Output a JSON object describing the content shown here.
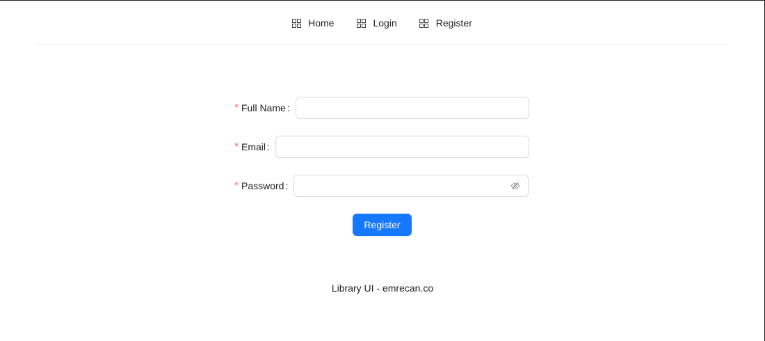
{
  "nav": {
    "items": [
      {
        "label": "Home",
        "icon": "appstore-icon"
      },
      {
        "label": "Login",
        "icon": "appstore-icon"
      },
      {
        "label": "Register",
        "icon": "appstore-icon"
      }
    ]
  },
  "form": {
    "full_name": {
      "label": "Full Name",
      "required_mark": "*",
      "colon": ":",
      "value": ""
    },
    "email": {
      "label": "Email",
      "required_mark": "*",
      "colon": ":",
      "value": ""
    },
    "password": {
      "label": "Password",
      "required_mark": "*",
      "colon": ":",
      "value": "",
      "toggle_icon": "eye-invisible-icon"
    },
    "submit_label": "Register"
  },
  "footer": {
    "text": "Library UI - emrecan.co"
  },
  "colors": {
    "primary": "#1677ff",
    "required": "#ff4d4f",
    "border": "#d9d9d9",
    "divider": "#f0f0f0"
  }
}
